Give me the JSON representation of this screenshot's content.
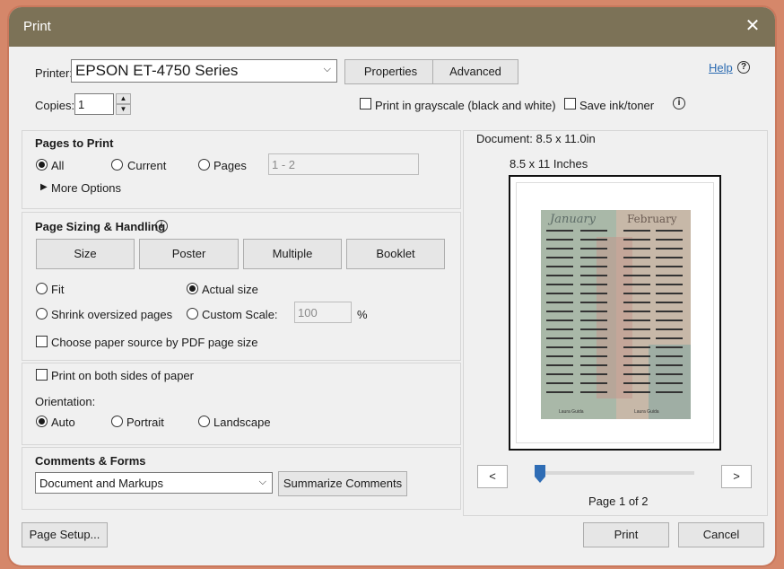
{
  "window": {
    "title": "Print",
    "close_glyph": "✕"
  },
  "printer": {
    "label": "Printer:",
    "selected": "EPSON ET-4750 Series",
    "properties_label": "Properties",
    "advanced_label": "Advanced",
    "help_label": "Help",
    "help_icon_glyph": "?"
  },
  "copies": {
    "label": "Copies:",
    "value": "1",
    "grayscale_label": "Print in grayscale (black and white)",
    "save_ink_label": "Save ink/toner",
    "info_glyph": "i"
  },
  "pages_to_print": {
    "heading": "Pages to Print",
    "all_label": "All",
    "current_label": "Current",
    "pages_label": "Pages",
    "pages_value": "1 - 2",
    "more_options_label": "More Options",
    "selected": "All"
  },
  "page_sizing": {
    "heading": "Page Sizing & Handling",
    "info_glyph": "i",
    "tabs": [
      "Size",
      "Poster",
      "Multiple",
      "Booklet"
    ],
    "fit_label": "Fit",
    "actual_size_label": "Actual size",
    "shrink_label": "Shrink oversized pages",
    "custom_scale_label": "Custom Scale:",
    "custom_scale_value": "100",
    "percent_label": "%",
    "paper_source_label": "Choose paper source by PDF page size",
    "selected": "Actual size"
  },
  "duplex": {
    "both_sides_label": "Print on both sides of paper",
    "orientation_label": "Orientation:",
    "auto_label": "Auto",
    "portrait_label": "Portrait",
    "landscape_label": "Landscape",
    "selected": "Auto"
  },
  "comments_forms": {
    "heading": "Comments & Forms",
    "selected": "Document and Markups",
    "summarize_label": "Summarize Comments"
  },
  "preview": {
    "document_size": "Document: 8.5 x 11.0in",
    "paper_size": "8.5 x 11 Inches",
    "prev_glyph": "<",
    "next_glyph": ">",
    "page_indicator": "Page 1 of 2",
    "page_fraction": 0.0,
    "thumbnail": {
      "month1": "January",
      "month2": "February",
      "footer1": "Laura Guida",
      "footer2": "Laura Guida",
      "colors": {
        "sage": "#a9b8a8",
        "stone": "#c7b8a8",
        "rose": "#c29a8f",
        "teal": "#8fa9a3"
      }
    }
  },
  "footer": {
    "page_setup_label": "Page Setup...",
    "print_label": "Print",
    "cancel_label": "Cancel"
  },
  "accent_color": "#2f6db5"
}
